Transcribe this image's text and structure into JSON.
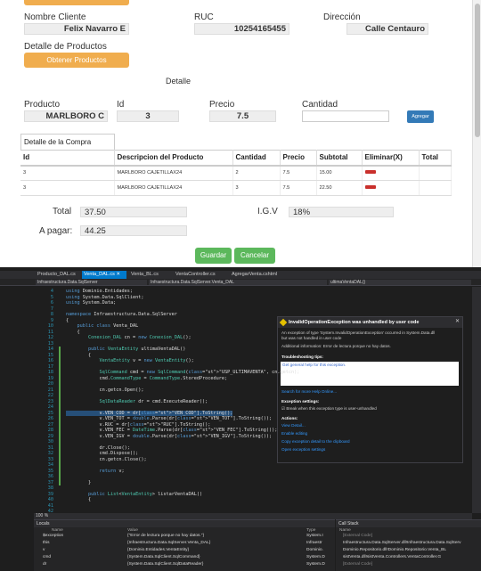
{
  "form": {
    "cliente_label": "Nombre Cliente",
    "cliente_value": "Felix Navarro E",
    "ruc_label": "RUC",
    "ruc_value": "10254165455",
    "direccion_label": "Dirección",
    "direccion_value": "Calle Centauro",
    "detalle_productos_label": "Detalle de Productos",
    "obtener_productos_label": "Obtener Productos",
    "detalle_label": "Detalle",
    "producto_label": "Producto",
    "producto_value": "MARLBORO C",
    "id_label": "Id",
    "id_value": "3",
    "precio_label": "Precio",
    "precio_value": "7.5",
    "cantidad_label": "Cantidad",
    "cantidad_value": "",
    "agregar_label": "Agregar",
    "grid_caption": "Detalle de la Compra",
    "grid_headers": [
      "Id",
      "Descripcion del Producto",
      "Cantidad",
      "Precio",
      "Subtotal",
      "Eliminar(X)",
      "Total"
    ],
    "grid_rows": [
      {
        "id": "3",
        "desc": "MARLBORO CAJETILLAX24",
        "cant": "2",
        "precio": "7.5",
        "subtotal": "15.00",
        "total": ""
      },
      {
        "id": "3",
        "desc": "MARLBORO CAJETILLAX24",
        "cant": "3",
        "precio": "7.5",
        "subtotal": "22.50",
        "total": ""
      }
    ],
    "total_label": "Total",
    "total_value": "37.50",
    "igv_label": "I.G.V",
    "igv_value": "18%",
    "apagar_label": "A pagar:",
    "apagar_value": "44.25",
    "guardar_label": "Guardar",
    "cancelar_label": "Cancelar"
  },
  "vs": {
    "tabs": [
      "Producto_DAL.cs",
      "Venta_DAL.cs ✕",
      "Venta_BL.cs",
      "VentaController.cs",
      "AgregarVenta.cshtml"
    ],
    "nav": [
      "Infraestructura.Data.SqlServer",
      "Infraestructura.Data.SqlServer.Venta_DAL",
      "ultimaVentaDAL()"
    ],
    "line_numbers": [
      "4",
      "5",
      "6",
      "7",
      "8",
      "9",
      "10",
      "11",
      "12",
      "13",
      "14",
      "15",
      "16",
      "17",
      "18",
      "19",
      "20",
      "21",
      "22",
      "23",
      "24",
      "25",
      "26",
      "27",
      "28",
      "29",
      "30",
      "31",
      "32",
      "33",
      "34",
      "35",
      "36",
      "37",
      "38",
      "39",
      "40",
      "41",
      "42"
    ],
    "code_lines": [
      "using Dominio.Entidades;",
      "using System.Data.SqlClient;",
      "using System.Data;",
      "",
      "namespace Infraestructura.Data.SqlServer",
      "{",
      "    public class Venta_DAL",
      "    {",
      "        Conexion_DAL cn = new Conexion_DAL();",
      "",
      "        public VentaEntity ultimaVentaDAL()",
      "        {",
      "            VentaEntity v = new VentaEntity();",
      "",
      "            SqlCommand cmd = new SqlCommand(\"USP_ULTIMAVENTA\", cn.getcn);",
      "            cmd.CommandType = CommandType.StoredProcedure;",
      "",
      "            cn.getcn.Open();",
      "",
      "            SqlDataReader dr = cmd.ExecuteReader();",
      "",
      "            v.VEN_COD = dr[\"VEN_COD\"].ToString();",
      "            v.VEN_TOT = double.Parse(dr[\"VEN_TOT\"].ToString());",
      "            v.RUC = dr[\"RUC\"].ToString();",
      "            v.VEN_FEC = DateTime.Parse(dr[\"VEN_FEC\"].ToString());",
      "            v.VEN_IGV = double.Parse(dr[\"VEN_IGV\"].ToString());",
      "",
      "            dr.Close();",
      "            cmd.Dispose();",
      "            cn.getcn.Close();",
      "",
      "            return v;",
      "",
      "        }",
      "",
      "        public List<VentaEntity> listarVentaDAL()",
      "        {",
      "",
      ""
    ],
    "exception": {
      "title": "InvalidOperationException was unhandled by user code",
      "line1": "An exception of type 'System.InvalidOperationException' occurred in System.Data.dll",
      "line2": "but was not handled in user code",
      "info": "Additional information: Error de lectura porque no hay datos.",
      "tips_title": "Troubleshooting tips:",
      "tip": "Get general help for this exception.",
      "help_link": "Search for more Help Online...",
      "settings_title": "Exception settings:",
      "settings_check": "Break when this exception type is user-unhandled",
      "actions_title": "Actions:",
      "actions": [
        "View Detail...",
        "Enable editing",
        "Copy exception detail to the clipboard",
        "Open exception settings"
      ]
    },
    "zoom": "100 %",
    "locals_title": "Locals",
    "locals_headers": [
      "Name",
      "Value",
      "Type"
    ],
    "locals_rows": [
      {
        "name": "$exception",
        "value": "{\"Error de lectura porque no hay datos.\"}",
        "type": "System.I"
      },
      {
        "name": "this",
        "value": "{Infraestructura.Data.SqlServer.Venta_DAL}",
        "type": "Infraestr"
      },
      {
        "name": "v",
        "value": "{Dominio.Entidades.VentaEntity}",
        "type": "Dominio."
      },
      {
        "name": "cmd",
        "value": "{System.Data.SqlClient.SqlCommand}",
        "type": "System.D"
      },
      {
        "name": "dr",
        "value": "{System.Data.SqlClient.SqlDataReader}",
        "type": "System.D"
      }
    ],
    "callstack_title": "Call Stack",
    "callstack_header": "Name",
    "callstack_rows": [
      "[External Code]",
      "Infraestructura.Data.SqlServer.dll!Infraestructura.Data.SqlServ",
      "Dominio.Repositorio.dll!Dominio.Repositorio.Venta_BL",
      "sistVenta.dll!sistVenta.Controllers.VentaController.G",
      "[External Code]"
    ]
  }
}
